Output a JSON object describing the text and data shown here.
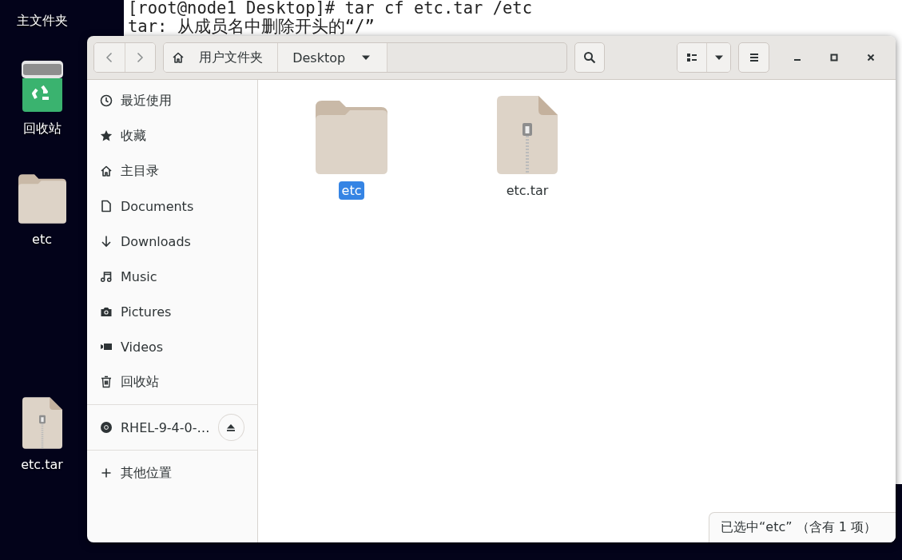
{
  "desktop": {
    "icons": [
      {
        "label": "主文件夹",
        "kind": "label"
      },
      {
        "label": "回收站",
        "kind": "trash"
      },
      {
        "label": "etc",
        "kind": "folder"
      },
      {
        "label": "etc.tar",
        "kind": "archive"
      }
    ]
  },
  "terminal": {
    "lines": [
      "[root@node1 Desktop]# tar cf etc.tar /etc",
      "tar: 从成员名中删除开头的“/”"
    ]
  },
  "file_manager": {
    "path": [
      {
        "label": "用户文件夹",
        "kind": "home"
      },
      {
        "label": "Desktop",
        "kind": "dropdown"
      }
    ],
    "sidebar": {
      "groups": [
        [
          {
            "label": "最近使用",
            "kind": "recent"
          },
          {
            "label": "收藏",
            "kind": "starred"
          },
          {
            "label": "主目录",
            "kind": "home"
          },
          {
            "label": "Documents",
            "kind": "document"
          },
          {
            "label": "Downloads",
            "kind": "download"
          },
          {
            "label": "Music",
            "kind": "music"
          },
          {
            "label": "Pictures",
            "kind": "picture"
          },
          {
            "label": "Videos",
            "kind": "video"
          },
          {
            "label": "回收站",
            "kind": "trash"
          }
        ],
        [
          {
            "label": "RHEL-9-4-0-…",
            "kind": "disc"
          }
        ],
        [
          {
            "label": "其他位置",
            "kind": "other"
          }
        ]
      ]
    },
    "files": [
      {
        "name": "etc",
        "kind": "folder",
        "selected": true
      },
      {
        "name": "etc.tar",
        "kind": "archive",
        "selected": false
      }
    ],
    "status": "已选中“etc” （含有 1 项）"
  }
}
